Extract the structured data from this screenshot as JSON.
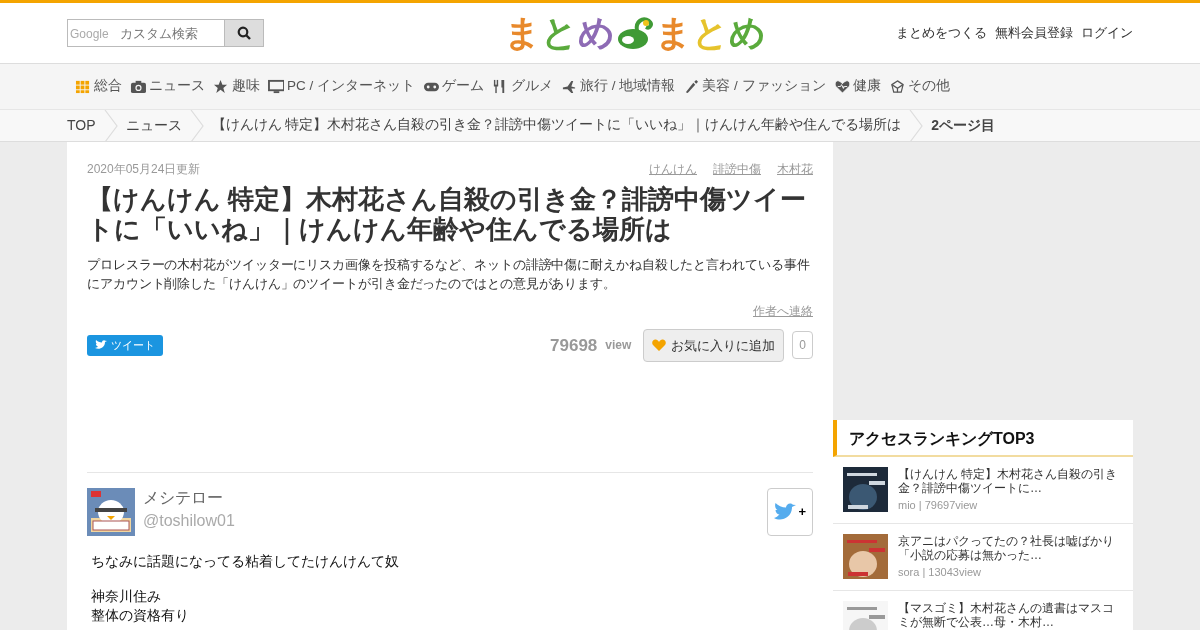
{
  "header": {
    "search": {
      "brand": "Google",
      "placeholder": "カスタム検索"
    },
    "logo": [
      {
        "text": "ま",
        "color": "#e8892b"
      },
      {
        "text": "と",
        "color": "#5aaa3c"
      },
      {
        "text": "め",
        "color": "#8e6bb5"
      },
      {
        "text": "ま",
        "color": "#e8892b"
      },
      {
        "text": "と",
        "color": "#e6c32c"
      },
      {
        "text": "め",
        "color": "#5aaa3c"
      }
    ],
    "links": [
      "まとめをつくる",
      "無料会員登録",
      "ログイン"
    ]
  },
  "categories": [
    "総合",
    "ニュース",
    "趣味",
    "PC / インターネット",
    "ゲーム",
    "グルメ",
    "旅行 / 地域情報",
    "美容 / ファッション",
    "健康",
    "その他"
  ],
  "breadcrumb": [
    "TOP",
    "ニュース",
    "【けんけん 特定】木村花さん自殺の引き金？誹謗中傷ツイートに「いいね」｜けんけん年齢や住んでる場所は",
    "2ページ目"
  ],
  "article": {
    "updated": "2020年05月24日更新",
    "tags": [
      "けんけん",
      "誹謗中傷",
      "木村花"
    ],
    "title": "【けんけん 特定】木村花さん自殺の引き金？誹謗中傷ツイートに「いいね」｜けんけん年齢や住んでる場所は",
    "description": "プロレスラーの木村花がツイッターにリスカ画像を投稿するなど、ネットの誹謗中傷に耐えかね自殺したと言われている事件にアカウント削除した「けんけん」のツイートが引き金だったのではとの意見があります。",
    "contact": "作者へ連絡",
    "tweet_button": "ツイート",
    "views": "79698",
    "views_unit": "view",
    "favorite_button": "お気に入りに追加",
    "favorite_count": "0",
    "tweet": {
      "name": "メシテロー",
      "handle": "@toshilow01",
      "follow_plus": "+",
      "paragraphs": [
        {
          "lines": [
            "ちなみに話題になってる粘着してたけんけんて奴"
          ]
        },
        {
          "lines": [
            "神奈川住み",
            "整体の資格有り"
          ]
        }
      ]
    }
  },
  "sidebar": {
    "title": "アクセスランキングTOP3",
    "items": [
      {
        "title": "【けんけん 特定】木村花さん自殺の引き金？誹謗中傷ツイートに…",
        "meta": "mio | 79697view",
        "kind": "picture"
      },
      {
        "title": "京アニはパクってたの？社長は嘘ばかり「小説の応募は無かった…",
        "meta": "sora | 13043view",
        "kind": "picture"
      },
      {
        "title": "【マスゴミ】木村花さんの遺書はマスコミが無断で公表…母・木村…",
        "kind": "picture"
      }
    ]
  }
}
